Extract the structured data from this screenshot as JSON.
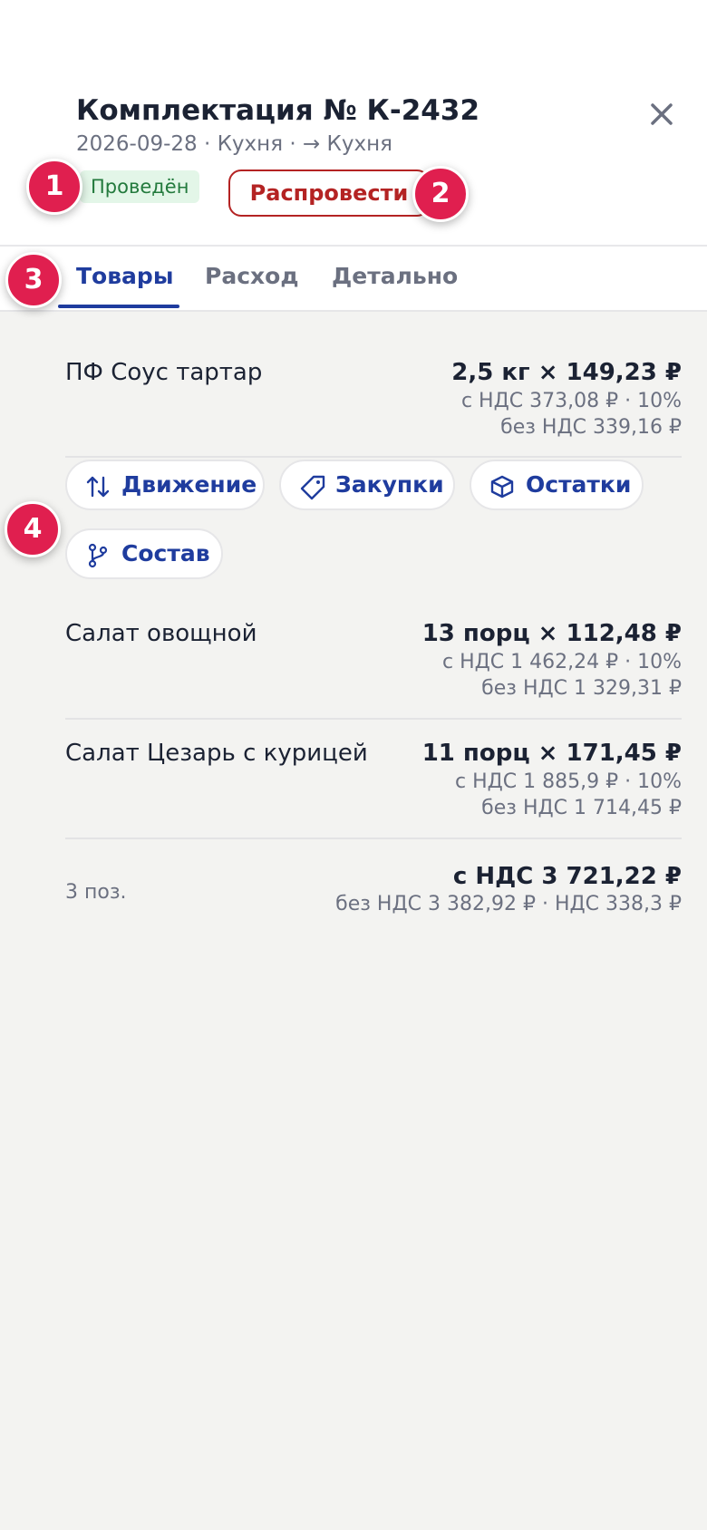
{
  "header": {
    "title": "Комплектация № К-2432",
    "subtitle": "2026-09-28 · Кухня · → Кухня",
    "status": "Проведён",
    "unpost_label": "Распровести",
    "close_icon": "close-icon"
  },
  "markers": [
    "1",
    "2",
    "3",
    "4"
  ],
  "tabs": [
    {
      "label": "Товары",
      "active": true
    },
    {
      "label": "Расход",
      "active": false
    },
    {
      "label": "Детально",
      "active": false
    }
  ],
  "items": [
    {
      "name": "ПФ Соус тартар",
      "qty": "2,5 кг × 149,23 ₽",
      "with_vat": "с НДС 373,08 ₽ · 10%",
      "without_vat": "без НДС 339,16 ₽"
    },
    {
      "name": "Салат овощной",
      "qty": "13 порц × 112,48 ₽",
      "with_vat": "с НДС 1 462,24 ₽ · 10%",
      "without_vat": "без НДС 1 329,31 ₽"
    },
    {
      "name": "Салат Цезарь с курицей",
      "qty": "11 порц × 171,45 ₽",
      "with_vat": "с НДС 1 885,9 ₽ · 10%",
      "without_vat": "без НДС 1 714,45 ₽"
    }
  ],
  "actions": [
    {
      "label": "Движение",
      "icon": "arrows-up-down-icon"
    },
    {
      "label": "Закупки",
      "icon": "tag-icon"
    },
    {
      "label": "Остатки",
      "icon": "box-icon"
    },
    {
      "label": "Состав",
      "icon": "branch-icon"
    }
  ],
  "footer": {
    "count": "3 поз.",
    "total_with_vat": "с НДС 3 721,22 ₽",
    "total_without_vat": "без НДС 3 382,92 ₽ · НДС 338,3 ₽"
  },
  "colors": {
    "accent": "#1f3c9e",
    "danger": "#b42323",
    "success": "#237a3d",
    "marker": "#e01f4f"
  }
}
